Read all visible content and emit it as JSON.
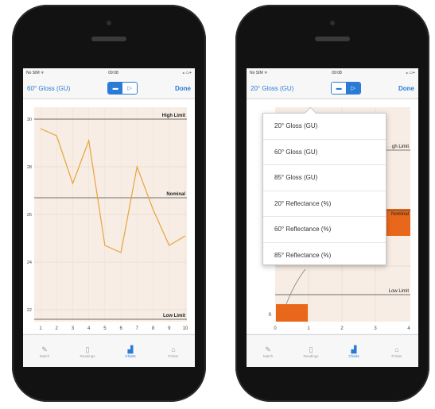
{
  "left_phone": {
    "status": {
      "carrier": "No SIM ᯤ",
      "time": "09:08",
      "battery": "⁎ ▭+"
    },
    "nav": {
      "title": "60° Gloss (GU)",
      "done": "Done"
    },
    "chart_data": {
      "type": "line",
      "x": [
        1,
        2,
        3,
        4,
        5,
        6,
        7,
        8,
        9,
        10
      ],
      "y_ticks": [
        "30",
        "28",
        "26",
        "24",
        "22"
      ],
      "x_ticks": [
        "1",
        "2",
        "3",
        "4",
        "5",
        "6",
        "7",
        "8",
        "9",
        "10"
      ],
      "ylim": [
        21.5,
        30.5
      ],
      "series": [
        {
          "values": [
            29.6,
            29.3,
            27.3,
            29.1,
            24.7,
            24.4,
            28.0,
            26.2,
            24.7,
            25.1
          ]
        }
      ],
      "reference_lines": [
        {
          "label": "High Limit",
          "value": 30
        },
        {
          "label": "Nominal",
          "value": 26.7
        },
        {
          "label": "Low Limit",
          "value": 21.6
        }
      ],
      "line_color": "#e8a33c"
    },
    "tabs": [
      {
        "icon": "✎",
        "label": "Match"
      },
      {
        "icon": "▯",
        "label": "Readings"
      },
      {
        "icon": "▟",
        "label": "Charts"
      },
      {
        "icon": "⌂",
        "label": "Printer"
      }
    ]
  },
  "right_phone": {
    "status": {
      "carrier": "No SIM ᯤ",
      "time": "09:08",
      "battery": "⁎ ▭+"
    },
    "nav": {
      "title": "20° Gloss (GU)",
      "done": "Done"
    },
    "popover_items": [
      "20° Gloss (GU)",
      "60° Gloss (GU)",
      "85° Gloss (GU)",
      "20° Reflectance (%)",
      "60° Reflectance (%)",
      "85° Reflectance (%)"
    ],
    "chart_data": {
      "type": "bar",
      "x_ticks": [
        "0",
        "1",
        "2",
        "3",
        "4"
      ],
      "y_ticks": [
        "0"
      ],
      "labels": {
        "high": "gh Limit",
        "nominal": "Nominal",
        "low": "Low Limit"
      },
      "bar_color": "#e8671a"
    },
    "tabs": [
      {
        "icon": "✎",
        "label": "Match"
      },
      {
        "icon": "▯",
        "label": "Readings"
      },
      {
        "icon": "▟",
        "label": "Charts"
      },
      {
        "icon": "⌂",
        "label": "Printer"
      }
    ]
  },
  "colors": {
    "accent": "#2a7bd6",
    "line": "#e8a33c",
    "bar": "#e8671a"
  }
}
